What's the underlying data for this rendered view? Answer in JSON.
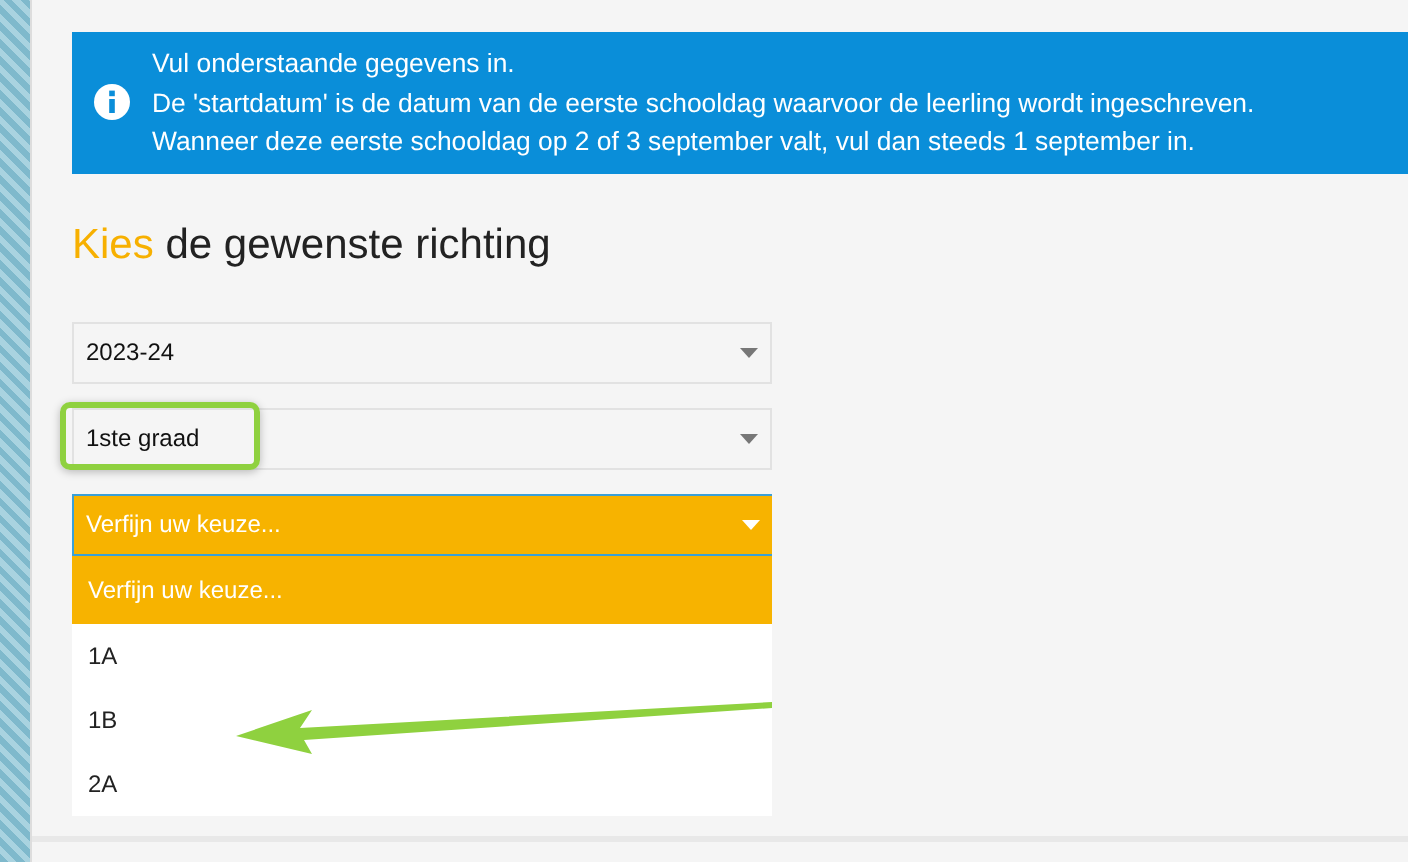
{
  "info": {
    "lines": [
      "Vul onderstaande gegevens in.",
      "De 'startdatum' is de datum van de eerste schooldag waarvoor de leerling wordt ingeschreven.",
      "Wanneer deze eerste schooldag op 2 of 3 september valt, vul dan steeds 1 september in."
    ]
  },
  "heading": {
    "accent": "Kies",
    "text": "de gewenste richting"
  },
  "selects": [
    {
      "value": "2023-24",
      "open": false,
      "highlighted": false
    },
    {
      "value": "1ste graad",
      "open": false,
      "highlighted": true
    },
    {
      "placeholder": "Verfijn uw keuze...",
      "open": true,
      "highlighted": false,
      "options": [
        {
          "label": "Verfijn uw keuze...",
          "selected": true
        },
        {
          "label": "1A",
          "selected": false
        },
        {
          "label": "1B",
          "selected": false,
          "arrow": true
        },
        {
          "label": "2A",
          "selected": false
        }
      ]
    }
  ]
}
